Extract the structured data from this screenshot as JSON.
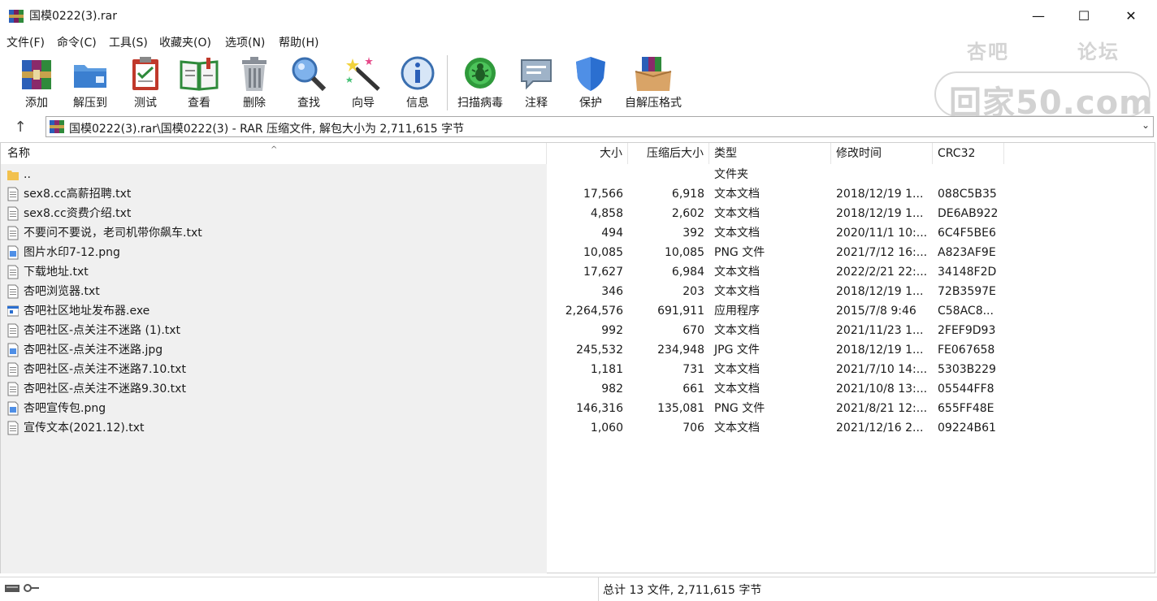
{
  "window": {
    "title": "国模0222(3).rar",
    "minimize": "—",
    "maximize": "☐",
    "close": "✕"
  },
  "menu": [
    "文件(F)",
    "命令(C)",
    "工具(S)",
    "收藏夹(O)",
    "选项(N)",
    "帮助(H)"
  ],
  "toolbar": {
    "add": "添加",
    "extract": "解压到",
    "test": "测试",
    "view": "查看",
    "delete": "删除",
    "find": "查找",
    "wizard": "向导",
    "info": "信息",
    "virus": "扫描病毒",
    "comment": "注释",
    "protect": "保护",
    "sfx": "自解压格式"
  },
  "watermark": {
    "left_text": "杏吧",
    "right_text": "论坛",
    "big_text": "回家50.com"
  },
  "address": {
    "up": "↑",
    "path": "国模0222(3).rar\\国模0222(3) - RAR 压缩文件, 解包大小为 2,711,615 字节",
    "dropdown": "⌄"
  },
  "columns": {
    "name": "名称",
    "size": "大小",
    "packed": "压缩后大小",
    "type": "类型",
    "modified": "修改时间",
    "crc": "CRC32",
    "sort_indicator": "^"
  },
  "files": [
    {
      "name": "..",
      "size": "",
      "packed": "",
      "type": "文件夹",
      "modified": "",
      "crc": "",
      "icon": "folder-icon"
    },
    {
      "name": "sex8.cc高薪招聘.txt",
      "size": "17,566",
      "packed": "6,918",
      "type": "文本文档",
      "modified": "2018/12/19 1...",
      "crc": "088C5B35",
      "icon": "text-file-icon"
    },
    {
      "name": "sex8.cc资费介绍.txt",
      "size": "4,858",
      "packed": "2,602",
      "type": "文本文档",
      "modified": "2018/12/19 1...",
      "crc": "DE6AB922",
      "icon": "text-file-icon"
    },
    {
      "name": "不要问不要说，老司机带你飙车.txt",
      "size": "494",
      "packed": "392",
      "type": "文本文档",
      "modified": "2020/11/1 10:...",
      "crc": "6C4F5BE6",
      "icon": "text-file-icon"
    },
    {
      "name": "图片水印7-12.png",
      "size": "10,085",
      "packed": "10,085",
      "type": "PNG 文件",
      "modified": "2021/7/12 16:...",
      "crc": "A823AF9E",
      "icon": "image-file-icon"
    },
    {
      "name": "下载地址.txt",
      "size": "17,627",
      "packed": "6,984",
      "type": "文本文档",
      "modified": "2022/2/21 22:...",
      "crc": "34148F2D",
      "icon": "text-file-icon"
    },
    {
      "name": "杏吧浏览器.txt",
      "size": "346",
      "packed": "203",
      "type": "文本文档",
      "modified": "2018/12/19 1...",
      "crc": "72B3597E",
      "icon": "text-file-icon"
    },
    {
      "name": "杏吧社区地址发布器.exe",
      "size": "2,264,576",
      "packed": "691,911",
      "type": "应用程序",
      "modified": "2015/7/8 9:46",
      "crc": "C58AC8...",
      "icon": "exe-file-icon"
    },
    {
      "name": "杏吧社区-点关注不迷路 (1).txt",
      "size": "992",
      "packed": "670",
      "type": "文本文档",
      "modified": "2021/11/23 1...",
      "crc": "2FEF9D93",
      "icon": "text-file-icon"
    },
    {
      "name": "杏吧社区-点关注不迷路.jpg",
      "size": "245,532",
      "packed": "234,948",
      "type": "JPG 文件",
      "modified": "2018/12/19 1...",
      "crc": "FE067658",
      "icon": "image-file-icon"
    },
    {
      "name": "杏吧社区-点关注不迷路7.10.txt",
      "size": "1,181",
      "packed": "731",
      "type": "文本文档",
      "modified": "2021/7/10 14:...",
      "crc": "5303B229",
      "icon": "text-file-icon"
    },
    {
      "name": "杏吧社区-点关注不迷路9.30.txt",
      "size": "982",
      "packed": "661",
      "type": "文本文档",
      "modified": "2021/10/8 13:...",
      "crc": "05544FF8",
      "icon": "text-file-icon"
    },
    {
      "name": "杏吧宣传包.png",
      "size": "146,316",
      "packed": "135,081",
      "type": "PNG 文件",
      "modified": "2021/8/21 12:...",
      "crc": "655FF48E",
      "icon": "image-file-icon"
    },
    {
      "name": "宣传文本(2021.12).txt",
      "size": "1,060",
      "packed": "706",
      "type": "文本文档",
      "modified": "2021/12/16 2...",
      "crc": "09224B61",
      "icon": "text-file-icon"
    }
  ],
  "status": {
    "summary": "总计 13 文件, 2,711,615 字节"
  },
  "colors": {
    "pane_grey": "#f0f0f0",
    "folder": "#f2c14e",
    "accent_blue": "#1e6fd0"
  }
}
